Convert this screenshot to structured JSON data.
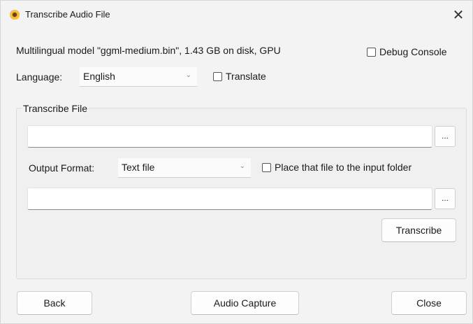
{
  "window": {
    "title": "Transcribe Audio File",
    "close_glyph": "✕",
    "app_icon": "sunflower-icon"
  },
  "model_info": "Multilingual model \"ggml-medium.bin\", 1.43 GB on disk, GPU",
  "debug_console": {
    "label": "Debug Console",
    "checked": false
  },
  "language": {
    "label": "Language:",
    "selected": "English",
    "chevron": "⌄"
  },
  "translate": {
    "label": "Translate",
    "checked": false
  },
  "transcribe_group": {
    "title": "Transcribe File",
    "input_file": {
      "value": "",
      "browse_label": "..."
    },
    "output_format": {
      "label": "Output Format:",
      "selected": "Text file",
      "chevron": "⌄"
    },
    "place_in_input_folder": {
      "label": "Place that file to the input folder",
      "checked": false
    },
    "output_file": {
      "value": "",
      "browse_label": "..."
    },
    "transcribe_button": "Transcribe"
  },
  "footer": {
    "back_button": "Back",
    "audio_capture_button": "Audio Capture",
    "close_button": "Close"
  }
}
